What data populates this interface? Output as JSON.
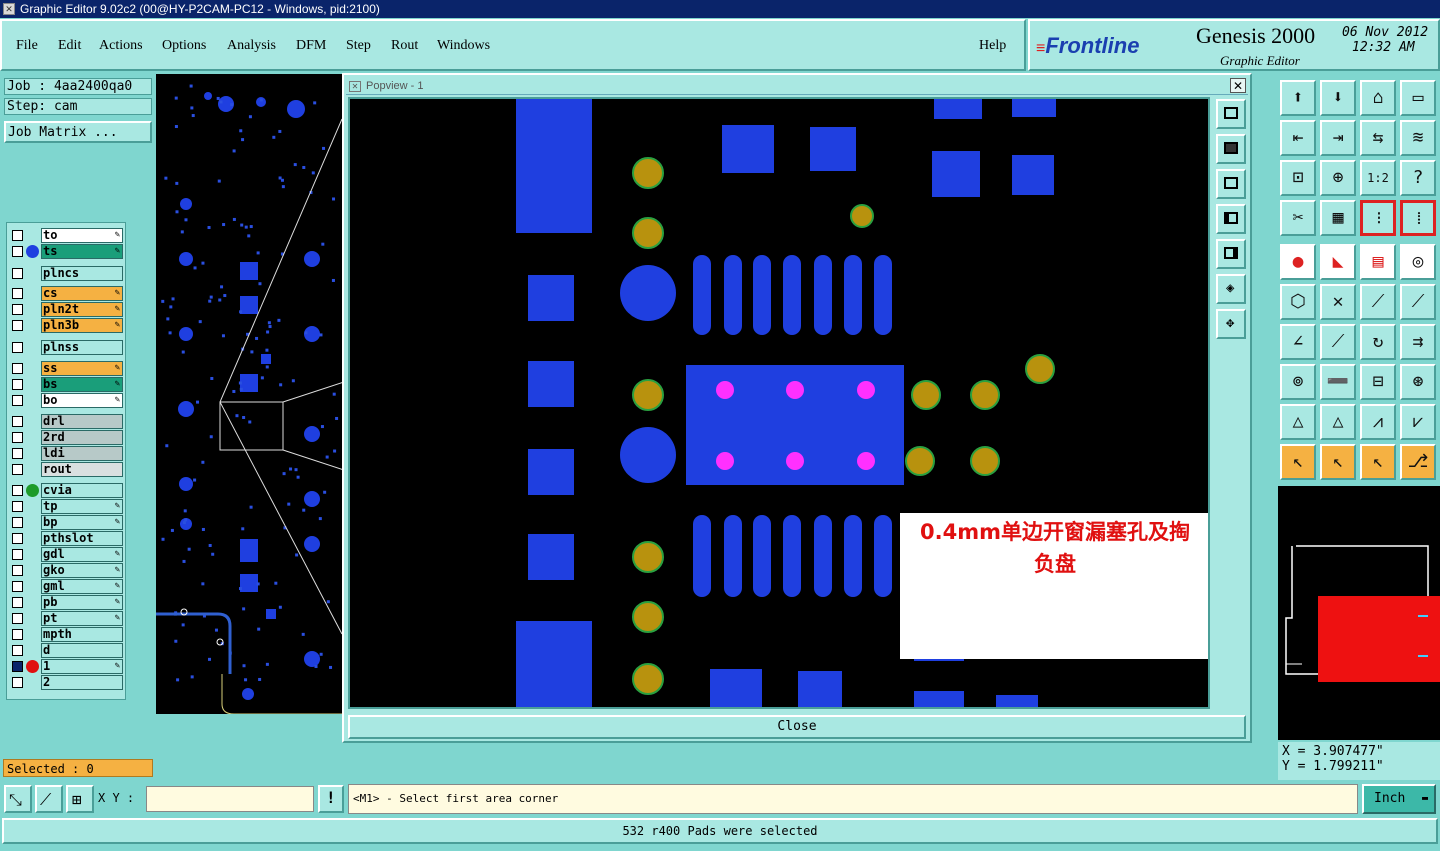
{
  "window": {
    "title": "Graphic Editor 9.02c2 (00@HY-P2CAM-PC12 - Windows, pid:2100)"
  },
  "menu": {
    "items": [
      "File",
      "Edit",
      "Actions",
      "Options",
      "Analysis",
      "DFM",
      "Step",
      "Rout",
      "Windows"
    ],
    "help": "Help"
  },
  "brand": {
    "logo": "Frontline",
    "product": "Genesis 2000",
    "subtitle": "Graphic Editor",
    "date": "06 Nov 2012",
    "time": "12:32 AM"
  },
  "job": {
    "label": "Job : 4aa2400qa0",
    "step": "Step: cam",
    "matrix_button": "Job Matrix ..."
  },
  "layers": [
    {
      "name": "to",
      "color": "#ffffff",
      "dot": "",
      "editable": true
    },
    {
      "name": "ts",
      "color": "#1a9e7a",
      "dot": "#1f3fe0",
      "editable": true
    },
    {
      "name": "plncs",
      "color": "#a9e8e2",
      "dot": "",
      "editable": false
    },
    {
      "name": "cs",
      "color": "#f5b142",
      "dot": "",
      "editable": true
    },
    {
      "name": "pln2t",
      "color": "#f5b142",
      "dot": "",
      "editable": true
    },
    {
      "name": "pln3b",
      "color": "#f5b142",
      "dot": "",
      "editable": true
    },
    {
      "name": "plnss",
      "color": "#a9e8e2",
      "dot": "",
      "editable": false
    },
    {
      "name": "ss",
      "color": "#f5b142",
      "dot": "",
      "editable": true
    },
    {
      "name": "bs",
      "color": "#1a9e7a",
      "dot": "",
      "editable": true
    },
    {
      "name": "bo",
      "color": "#ffffff",
      "dot": "",
      "editable": true
    },
    {
      "name": "drl",
      "color": "#b7c9c8",
      "dot": "",
      "editable": false
    },
    {
      "name": "2rd",
      "color": "#b7c9c8",
      "dot": "",
      "editable": false
    },
    {
      "name": "ldi",
      "color": "#b7c9c8",
      "dot": "",
      "editable": false
    },
    {
      "name": "rout",
      "color": "#d9e0e0",
      "dot": "",
      "editable": false
    },
    {
      "name": "cvia",
      "color": "#a9e8e2",
      "dot": "#1e9b2a",
      "editable": false
    },
    {
      "name": "tp",
      "color": "#a9e8e2",
      "dot": "",
      "editable": true
    },
    {
      "name": "bp",
      "color": "#a9e8e2",
      "dot": "",
      "editable": true
    },
    {
      "name": "pthslot",
      "color": "#a9e8e2",
      "dot": "",
      "editable": false
    },
    {
      "name": "gdl",
      "color": "#a9e8e2",
      "dot": "",
      "editable": true
    },
    {
      "name": "gko",
      "color": "#a9e8e2",
      "dot": "",
      "editable": true
    },
    {
      "name": "gml",
      "color": "#a9e8e2",
      "dot": "",
      "editable": true
    },
    {
      "name": "pb",
      "color": "#a9e8e2",
      "dot": "",
      "editable": true
    },
    {
      "name": "pt",
      "color": "#a9e8e2",
      "dot": "",
      "editable": true
    },
    {
      "name": "mpth",
      "color": "#a9e8e2",
      "dot": "",
      "editable": false
    },
    {
      "name": "d",
      "color": "#a9e8e2",
      "dot": "",
      "editable": false
    },
    {
      "name": "1",
      "color": "#a9e8e2",
      "dot": "#e01010",
      "editable": true
    },
    {
      "name": "2",
      "color": "#a9e8e2",
      "dot": "",
      "editable": false
    }
  ],
  "popview": {
    "title": "Popview - 1",
    "annotation_line1": "0.4mm单边开窗漏塞孔及掏",
    "annotation_line2": "负盘",
    "close_label": "Close"
  },
  "coords": {
    "x": "X = 3.907477\"",
    "y": "Y = 1.799211\""
  },
  "selected": "Selected : 0",
  "command": {
    "xy_label": "X Y :",
    "xy_value": "",
    "prompt": "<M1> - Select first area corner",
    "units": "Inch"
  },
  "status": "532 r400 Pads were selected",
  "colors": {
    "pad_blue": "#1f3fe0",
    "via_gold": "#b8920e",
    "magenta": "#ff30ff",
    "panel": "#a9e8e2"
  }
}
